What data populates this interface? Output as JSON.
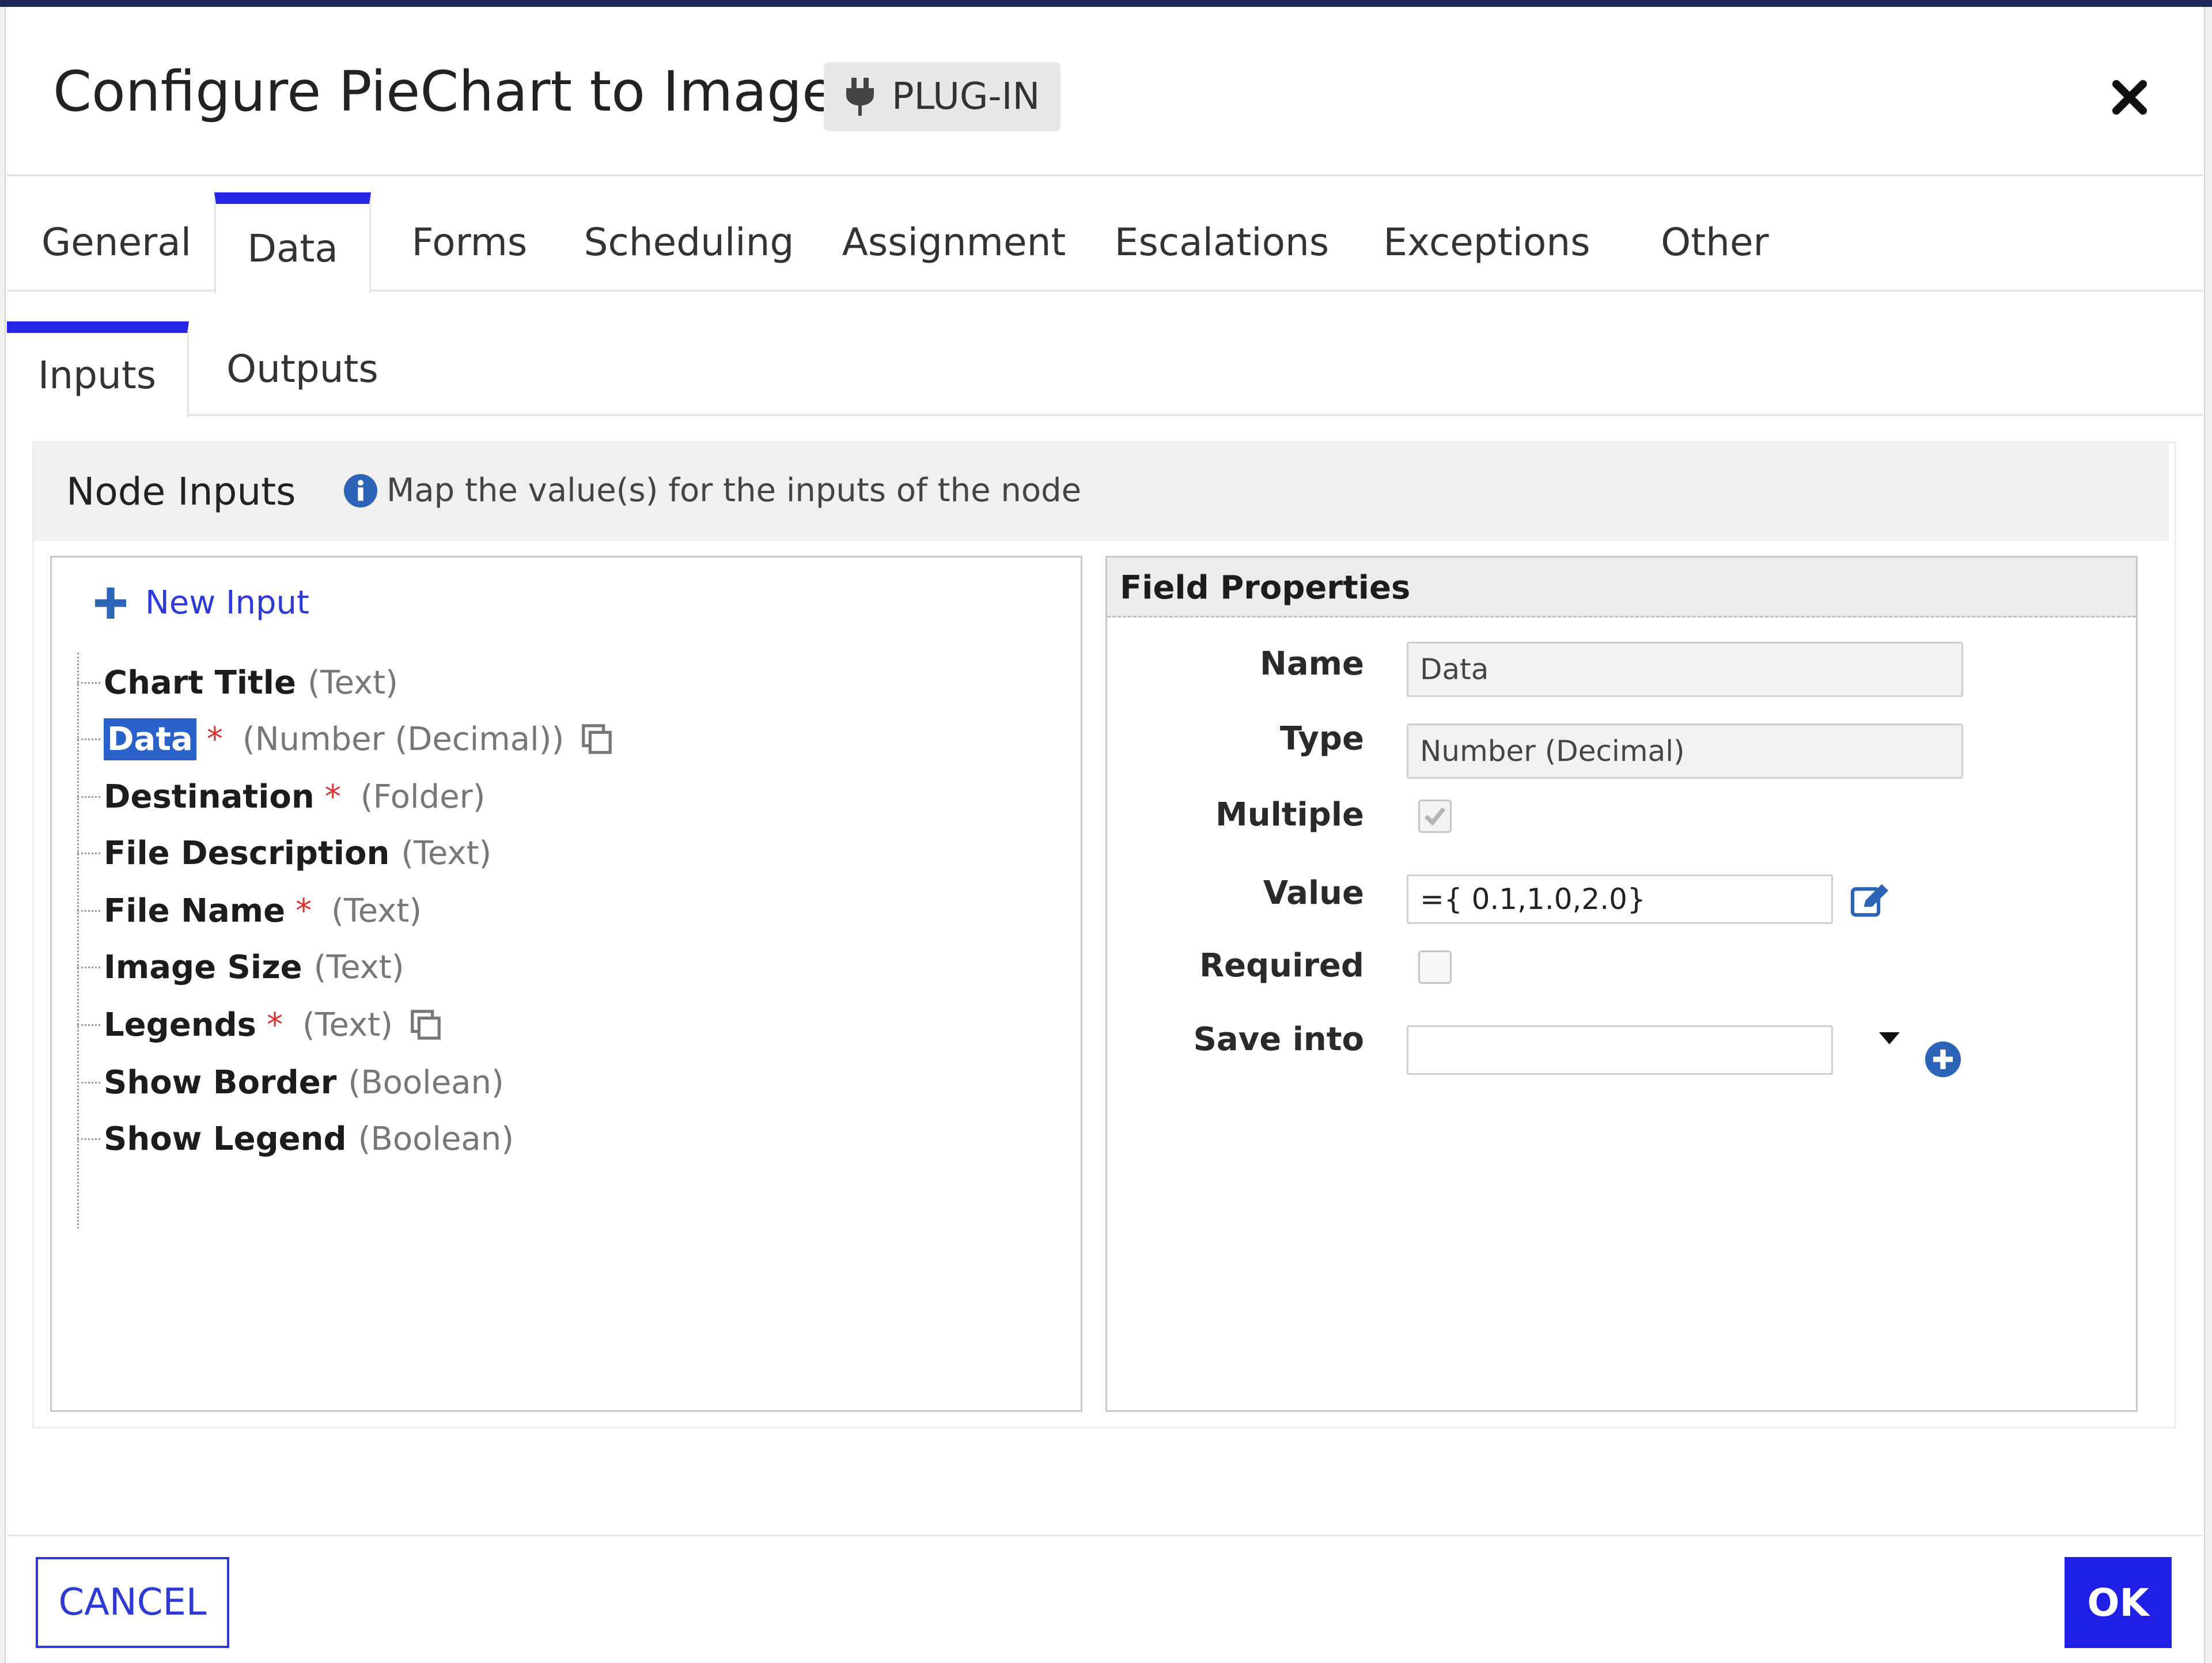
{
  "dialog": {
    "title": "Configure PieChart to Image",
    "badge": "PLUG-IN",
    "close_icon": "close-icon"
  },
  "tabs": [
    {
      "label": "General",
      "active": false
    },
    {
      "label": "Data",
      "active": true
    },
    {
      "label": "Forms",
      "active": false
    },
    {
      "label": "Scheduling",
      "active": false
    },
    {
      "label": "Assignment",
      "active": false
    },
    {
      "label": "Escalations",
      "active": false
    },
    {
      "label": "Exceptions",
      "active": false
    },
    {
      "label": "Other",
      "active": false
    }
  ],
  "subtabs": [
    {
      "label": "Inputs",
      "active": true
    },
    {
      "label": "Outputs",
      "active": false
    }
  ],
  "node_inputs": {
    "title": "Node Inputs",
    "info_text": "Map the value(s) for the inputs of the node",
    "new_input_label": "New Input",
    "items": [
      {
        "name": "Chart Title",
        "required": false,
        "type": "(Text)",
        "copy": false,
        "selected": false
      },
      {
        "name": "Data",
        "required": true,
        "type": "(Number (Decimal))",
        "copy": true,
        "selected": true
      },
      {
        "name": "Destination",
        "required": true,
        "type": "(Folder)",
        "copy": false,
        "selected": false
      },
      {
        "name": "File Description",
        "required": false,
        "type": "(Text)",
        "copy": false,
        "selected": false
      },
      {
        "name": "File Name",
        "required": true,
        "type": "(Text)",
        "copy": false,
        "selected": false
      },
      {
        "name": "Image Size",
        "required": false,
        "type": "(Text)",
        "copy": false,
        "selected": false
      },
      {
        "name": "Legends",
        "required": true,
        "type": "(Text)",
        "copy": true,
        "selected": false
      },
      {
        "name": "Show Border",
        "required": false,
        "type": "(Boolean)",
        "copy": false,
        "selected": false
      },
      {
        "name": "Show Legend",
        "required": false,
        "type": "(Boolean)",
        "copy": false,
        "selected": false
      }
    ],
    "required_mark": "*"
  },
  "field_properties": {
    "title": "Field Properties",
    "name_label": "Name",
    "name_value": "Data",
    "type_label": "Type",
    "type_value": "Number (Decimal)",
    "multiple_label": "Multiple",
    "multiple_checked": true,
    "value_label": "Value",
    "value_value": "={  0.1,1.0,2.0}",
    "required_label": "Required",
    "required_checked": false,
    "save_into_label": "Save into",
    "save_into_value": ""
  },
  "footer": {
    "cancel_label": "CANCEL",
    "ok_label": "OK"
  },
  "colors": {
    "accent": "#2525e6",
    "link": "#2e3ad6",
    "selected": "#2a62c9",
    "required": "#d93333"
  }
}
